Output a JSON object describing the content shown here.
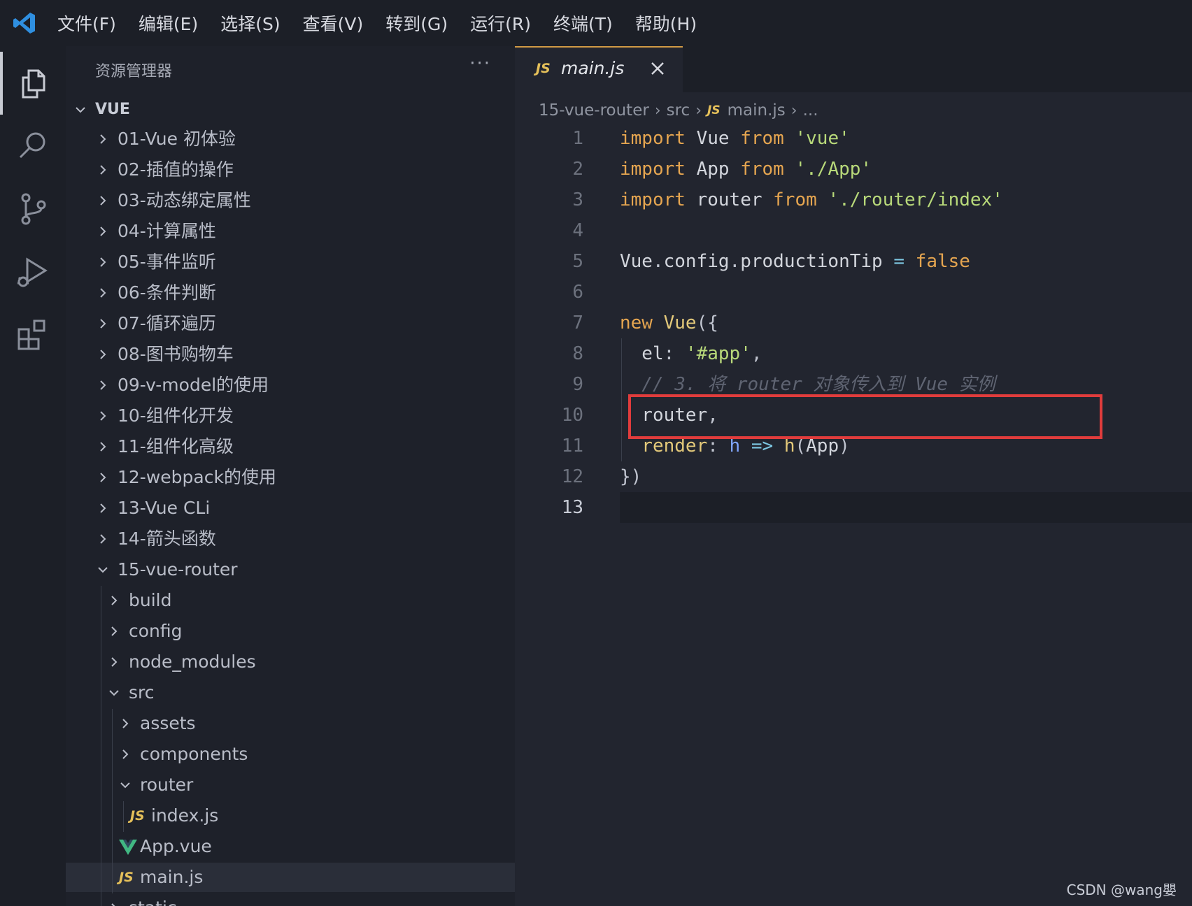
{
  "menu": [
    "文件(F)",
    "编辑(E)",
    "选择(S)",
    "查看(V)",
    "转到(G)",
    "运行(R)",
    "终端(T)",
    "帮助(H)"
  ],
  "activity_icons": [
    "explorer-icon",
    "search-icon",
    "source-control-icon",
    "run-debug-icon",
    "extensions-icon"
  ],
  "sidebar": {
    "title": "资源管理器",
    "more": "···",
    "root": "VUE",
    "items": [
      {
        "label": "01-Vue 初体验",
        "depth": 1,
        "type": "folder",
        "open": false
      },
      {
        "label": "02-插值的操作",
        "depth": 1,
        "type": "folder",
        "open": false
      },
      {
        "label": "03-动态绑定属性",
        "depth": 1,
        "type": "folder",
        "open": false
      },
      {
        "label": "04-计算属性",
        "depth": 1,
        "type": "folder",
        "open": false
      },
      {
        "label": "05-事件监听",
        "depth": 1,
        "type": "folder",
        "open": false
      },
      {
        "label": "06-条件判断",
        "depth": 1,
        "type": "folder",
        "open": false
      },
      {
        "label": "07-循环遍历",
        "depth": 1,
        "type": "folder",
        "open": false
      },
      {
        "label": "08-图书购物车",
        "depth": 1,
        "type": "folder",
        "open": false
      },
      {
        "label": "09-v-model的使用",
        "depth": 1,
        "type": "folder",
        "open": false
      },
      {
        "label": "10-组件化开发",
        "depth": 1,
        "type": "folder",
        "open": false
      },
      {
        "label": "11-组件化高级",
        "depth": 1,
        "type": "folder",
        "open": false
      },
      {
        "label": "12-webpack的使用",
        "depth": 1,
        "type": "folder",
        "open": false
      },
      {
        "label": "13-Vue CLi",
        "depth": 1,
        "type": "folder",
        "open": false
      },
      {
        "label": "14-箭头函数",
        "depth": 1,
        "type": "folder",
        "open": false
      },
      {
        "label": "15-vue-router",
        "depth": 1,
        "type": "folder",
        "open": true
      },
      {
        "label": "build",
        "depth": 2,
        "type": "folder",
        "open": false
      },
      {
        "label": "config",
        "depth": 2,
        "type": "folder",
        "open": false
      },
      {
        "label": "node_modules",
        "depth": 2,
        "type": "folder",
        "open": false
      },
      {
        "label": "src",
        "depth": 2,
        "type": "folder",
        "open": true
      },
      {
        "label": "assets",
        "depth": 3,
        "type": "folder",
        "open": false
      },
      {
        "label": "components",
        "depth": 3,
        "type": "folder",
        "open": false
      },
      {
        "label": "router",
        "depth": 3,
        "type": "folder",
        "open": true
      },
      {
        "label": "index.js",
        "depth": 4,
        "type": "js"
      },
      {
        "label": "App.vue",
        "depth": 3,
        "type": "vue"
      },
      {
        "label": "main.js",
        "depth": 3,
        "type": "js",
        "selected": true
      },
      {
        "label": "static",
        "depth": 2,
        "type": "folder",
        "open": false
      }
    ]
  },
  "tab": {
    "badge": "JS",
    "name": "main.js"
  },
  "breadcrumb": [
    "15-vue-router",
    "src",
    "main.js",
    "..."
  ],
  "code": {
    "current_line": 13,
    "lines": [
      [
        [
          "kw",
          "import"
        ],
        [
          "id",
          " Vue "
        ],
        [
          "kw",
          "from"
        ],
        [
          "id",
          " "
        ],
        [
          "str",
          "'vue'"
        ]
      ],
      [
        [
          "kw",
          "import"
        ],
        [
          "id",
          " App "
        ],
        [
          "kw",
          "from"
        ],
        [
          "id",
          " "
        ],
        [
          "str",
          "'./App'"
        ]
      ],
      [
        [
          "kw",
          "import"
        ],
        [
          "id",
          " router "
        ],
        [
          "kw",
          "from"
        ],
        [
          "id",
          " "
        ],
        [
          "str",
          "'./router/index'"
        ]
      ],
      [],
      [
        [
          "id",
          "Vue"
        ],
        [
          "punc",
          "."
        ],
        [
          "id",
          "config"
        ],
        [
          "punc",
          "."
        ],
        [
          "id",
          "productionTip "
        ],
        [
          "op",
          "="
        ],
        [
          "id",
          " "
        ],
        [
          "bool",
          "false"
        ]
      ],
      [],
      [
        [
          "kw",
          "new"
        ],
        [
          "id",
          " "
        ],
        [
          "fn",
          "Vue"
        ],
        [
          "punc",
          "({"
        ]
      ],
      [
        [
          "id",
          "  el"
        ],
        [
          "punc",
          ": "
        ],
        [
          "str",
          "'#app'"
        ],
        [
          "punc",
          ","
        ]
      ],
      [
        [
          "cmt",
          "  // 3. 将 router 对象传入到 Vue 实例"
        ]
      ],
      [
        [
          "id",
          "  router"
        ],
        [
          "punc",
          ","
        ]
      ],
      [
        [
          "fn",
          "  render"
        ],
        [
          "punc",
          ": "
        ],
        [
          "param",
          "h"
        ],
        [
          "id",
          " "
        ],
        [
          "op",
          "=>"
        ],
        [
          "id",
          " "
        ],
        [
          "fn",
          "h"
        ],
        [
          "punc",
          "("
        ],
        [
          "id",
          "App"
        ],
        [
          "punc",
          ")"
        ]
      ],
      [
        [
          "punc",
          "})"
        ]
      ],
      []
    ]
  },
  "watermark": "CSDN @wang嬰"
}
